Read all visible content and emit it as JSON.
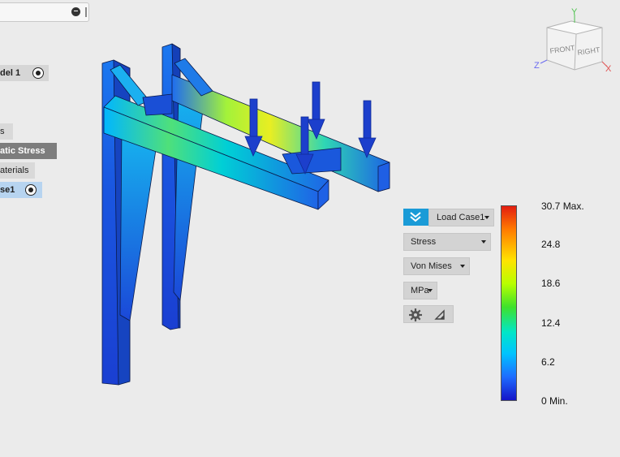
{
  "browser": {
    "items": [
      {
        "label": "del 1"
      },
      {
        "label": "s"
      },
      {
        "label": "atic Stress"
      },
      {
        "label": "aterials"
      },
      {
        "label": "se1"
      }
    ]
  },
  "viewcube": {
    "faces": {
      "front": "FRONT",
      "right": "RIGHT"
    },
    "axes": {
      "x": "X",
      "y": "Y",
      "z": "Z"
    }
  },
  "results_panel": {
    "load_case": "Load Case1",
    "result_type": "Stress",
    "component": "Von Mises",
    "units": "MPa",
    "icons": [
      "chevrons-down-icon",
      "gear-icon",
      "triangle-ruler-icon"
    ]
  },
  "legend": {
    "max_label": "30.7 Max.",
    "min_label": "0 Min.",
    "ticks": [
      "24.8",
      "18.6",
      "12.4",
      "6.2"
    ],
    "max_value": 30.7,
    "min_value": 0,
    "gradient": [
      "#e21d10",
      "#ff7b00",
      "#ffe300",
      "#3fe12c",
      "#00e6c8",
      "#00c3ff",
      "#1e6cff",
      "#1414c8"
    ]
  },
  "colors": {
    "background": "#ebebeb",
    "accent": "#1a9bd7",
    "load_arrow": "#1c3fcc",
    "selected_item": "#b7d4f0"
  }
}
